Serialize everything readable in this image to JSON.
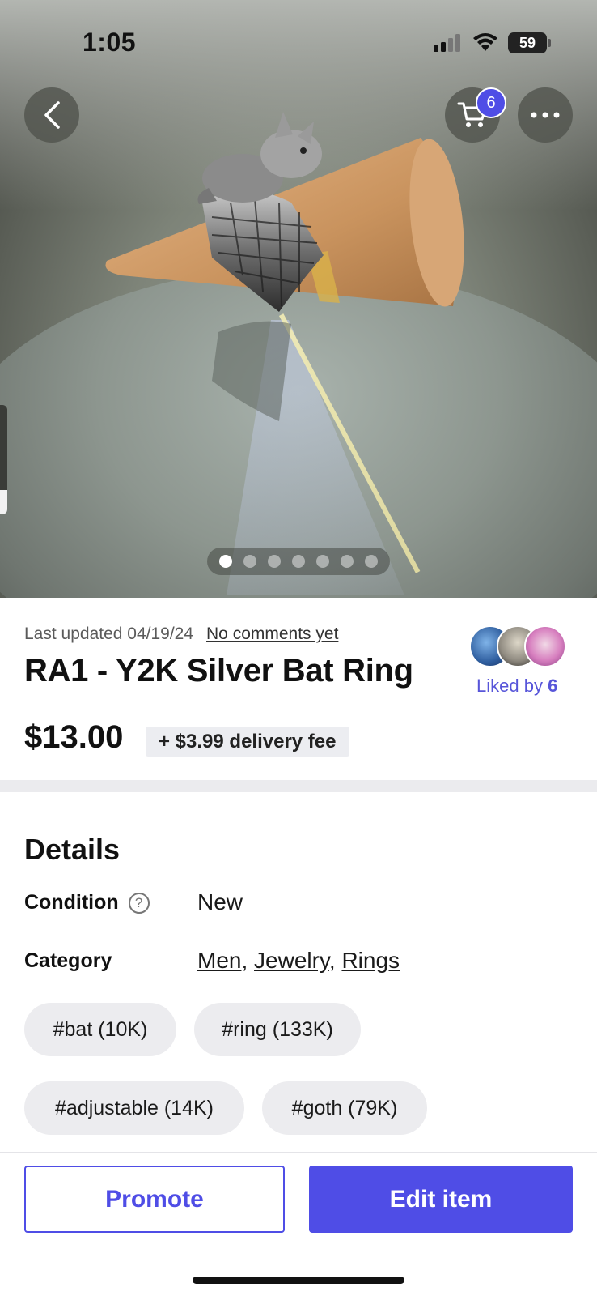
{
  "status_bar": {
    "time": "1:05",
    "battery": "59"
  },
  "header": {
    "cart_count": "6"
  },
  "gallery": {
    "image_count": 7,
    "active_index": 0
  },
  "listing": {
    "last_updated": "Last updated 04/19/24",
    "comments_link": "No comments yet",
    "title": "RA1 - Y2K Silver Bat Ring",
    "liked_prefix": "Liked by",
    "liked_count": "6",
    "price": "$13.00",
    "delivery_fee": "+ $3.99 delivery fee"
  },
  "details": {
    "heading": "Details",
    "condition_label": "Condition",
    "condition_value": "New",
    "category_label": "Category",
    "categories": [
      "Men",
      "Jewelry",
      "Rings"
    ],
    "tags": [
      "#bat (10K)",
      "#ring (133K)",
      "#adjustable (14K)",
      "#goth (79K)"
    ]
  },
  "actions": {
    "promote": "Promote",
    "edit": "Edit item"
  },
  "colors": {
    "accent": "#4f4de6"
  }
}
